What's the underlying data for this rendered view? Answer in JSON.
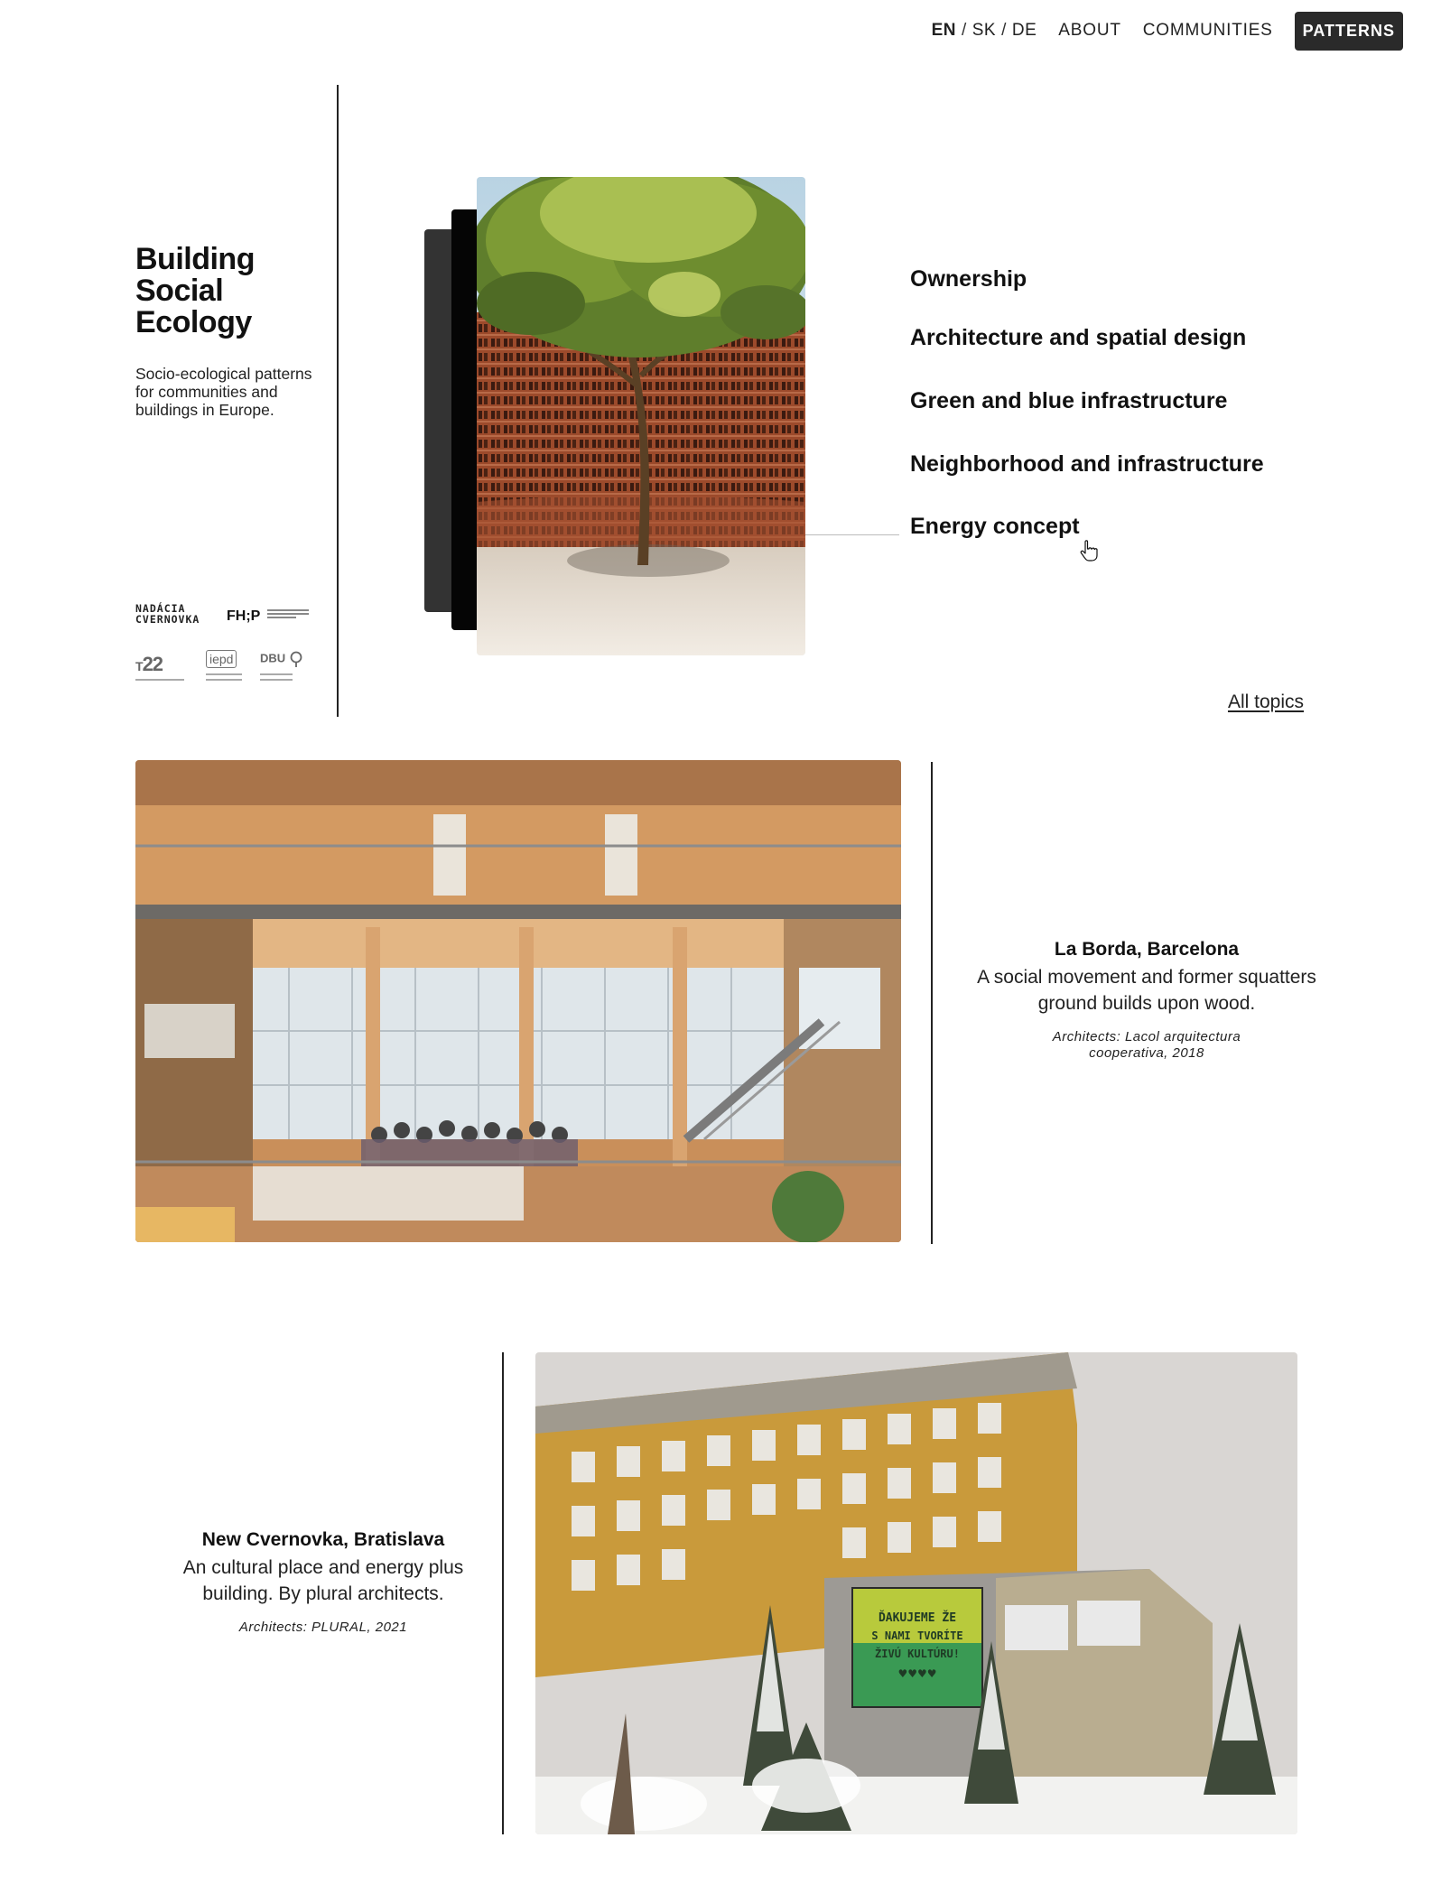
{
  "nav": {
    "languages": [
      {
        "code": "EN",
        "active": true
      },
      {
        "code": "SK",
        "active": false
      },
      {
        "code": "DE",
        "active": false
      }
    ],
    "separator": "/",
    "links": [
      "ABOUT",
      "COMMUNITIES"
    ],
    "active_button": "PATTERNS"
  },
  "sidebar": {
    "title": "Building Social Ecology",
    "subtitle": "Socio-ecological patterns for communities and buildings in Europe.",
    "logos": {
      "cvernovka": "NADÁCIA CVERNOVKA",
      "fhp": "FH;P",
      "l22": "22",
      "iepd": "iepd",
      "dbu": "DBU"
    }
  },
  "topics": [
    "Ownership",
    "Architecture and spatial design",
    "Green and blue infrastructure",
    "Neighborhood and infrastructure",
    "Energy concept"
  ],
  "all_topics_link": "All topics",
  "projects": [
    {
      "title": "La Borda, Barcelona",
      "description": "A social movement and former squatters ground builds upon wood.",
      "architects": "Architects: Lacol arquitectura cooperativa, 2018"
    },
    {
      "title": "New Cvernovka, Bratislava",
      "description": "An cultural place and energy plus building. By plural architects.",
      "architects": "Architects: PLURAL, 2021",
      "banner_text": [
        "ĎAKUJEME ŽE",
        "S NAMI TVORÍTE",
        "ŽIVÚ KULTÚRU!"
      ]
    }
  ],
  "colors": {
    "nav_button_bg": "#2a2a2a",
    "text": "#111111",
    "divider": "#222222"
  }
}
